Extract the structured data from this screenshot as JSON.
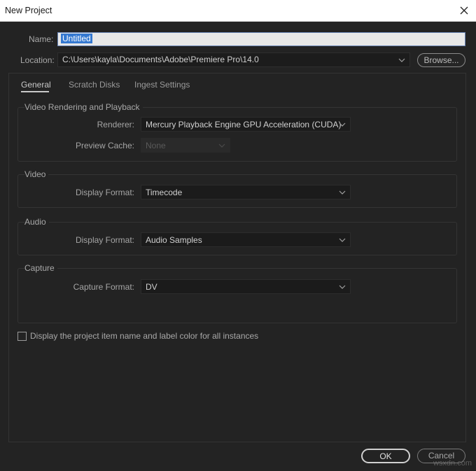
{
  "window": {
    "title": "New Project"
  },
  "name_field": {
    "label": "Name:",
    "value": "Untitled"
  },
  "location_field": {
    "label": "Location:",
    "value": "C:\\Users\\kayla\\Documents\\Adobe\\Premiere Pro\\14.0",
    "browse_label": "Browse..."
  },
  "tabs": [
    {
      "label": "General"
    },
    {
      "label": "Scratch Disks"
    },
    {
      "label": "Ingest Settings"
    }
  ],
  "video_rendering": {
    "title": "Video Rendering and Playback",
    "renderer_label": "Renderer:",
    "renderer_value": "Mercury Playback Engine GPU Acceleration (CUDA)",
    "preview_cache_label": "Preview Cache:",
    "preview_cache_value": "None"
  },
  "video": {
    "title": "Video",
    "display_format_label": "Display Format:",
    "display_format_value": "Timecode"
  },
  "audio": {
    "title": "Audio",
    "display_format_label": "Display Format:",
    "display_format_value": "Audio Samples"
  },
  "capture": {
    "title": "Capture",
    "capture_format_label": "Capture Format:",
    "capture_format_value": "DV"
  },
  "option": {
    "label": "Display the project item name and label color for all instances",
    "checked": false
  },
  "buttons": {
    "ok": "OK",
    "cancel": "Cancel"
  },
  "watermark": "wsxdn.com",
  "colors": {
    "background": "#232323",
    "selection": "#3478d0"
  },
  "icons": [
    "close-icon",
    "chevron-down-icon",
    "checkbox-icon"
  ]
}
